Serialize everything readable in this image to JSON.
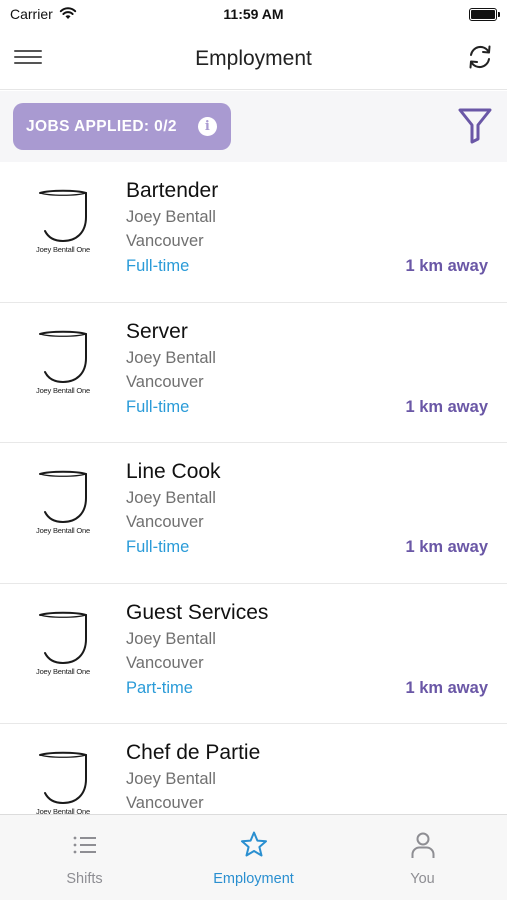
{
  "status_bar": {
    "carrier": "Carrier",
    "time": "11:59 AM",
    "wifi_icon": "wifi-icon",
    "battery_icon": "battery-icon"
  },
  "nav": {
    "title": "Employment",
    "menu_icon": "hamburger-menu-icon",
    "refresh_icon": "refresh-icon"
  },
  "filter_bar": {
    "jobs_applied_label": "JOBS APPLIED: 0/2",
    "info_glyph": "i",
    "filter_icon": "funnel-filter-icon",
    "badge_color": "#a99ad1",
    "accent_color": "#6a57a6"
  },
  "jobs": [
    {
      "title": "Bartender",
      "company": "Joey Bentall",
      "city": "Vancouver",
      "type": "Full-time",
      "distance": "1 km away",
      "logo_text": "Joey Bentall One"
    },
    {
      "title": "Server",
      "company": "Joey Bentall",
      "city": "Vancouver",
      "type": "Full-time",
      "distance": "1 km away",
      "logo_text": "Joey Bentall One"
    },
    {
      "title": "Line Cook",
      "company": "Joey Bentall",
      "city": "Vancouver",
      "type": "Full-time",
      "distance": "1 km away",
      "logo_text": "Joey Bentall One"
    },
    {
      "title": "Guest Services",
      "company": "Joey Bentall",
      "city": "Vancouver",
      "type": "Part-time",
      "distance": "1 km away",
      "logo_text": "Joey Bentall One"
    },
    {
      "title": "Chef de Partie",
      "company": "Joey Bentall",
      "city": "Vancouver",
      "type": "",
      "distance": "",
      "logo_text": "Joey Bentall One"
    }
  ],
  "tabs": [
    {
      "label": "Shifts",
      "icon": "list-icon",
      "active": false
    },
    {
      "label": "Employment",
      "icon": "star-icon",
      "active": true
    },
    {
      "label": "You",
      "icon": "person-icon",
      "active": false
    }
  ],
  "colors": {
    "job_type": "#2a9bd8",
    "distance": "#6a57a6",
    "tab_active": "#2a8fd0",
    "tab_inactive": "#8e8e93"
  }
}
